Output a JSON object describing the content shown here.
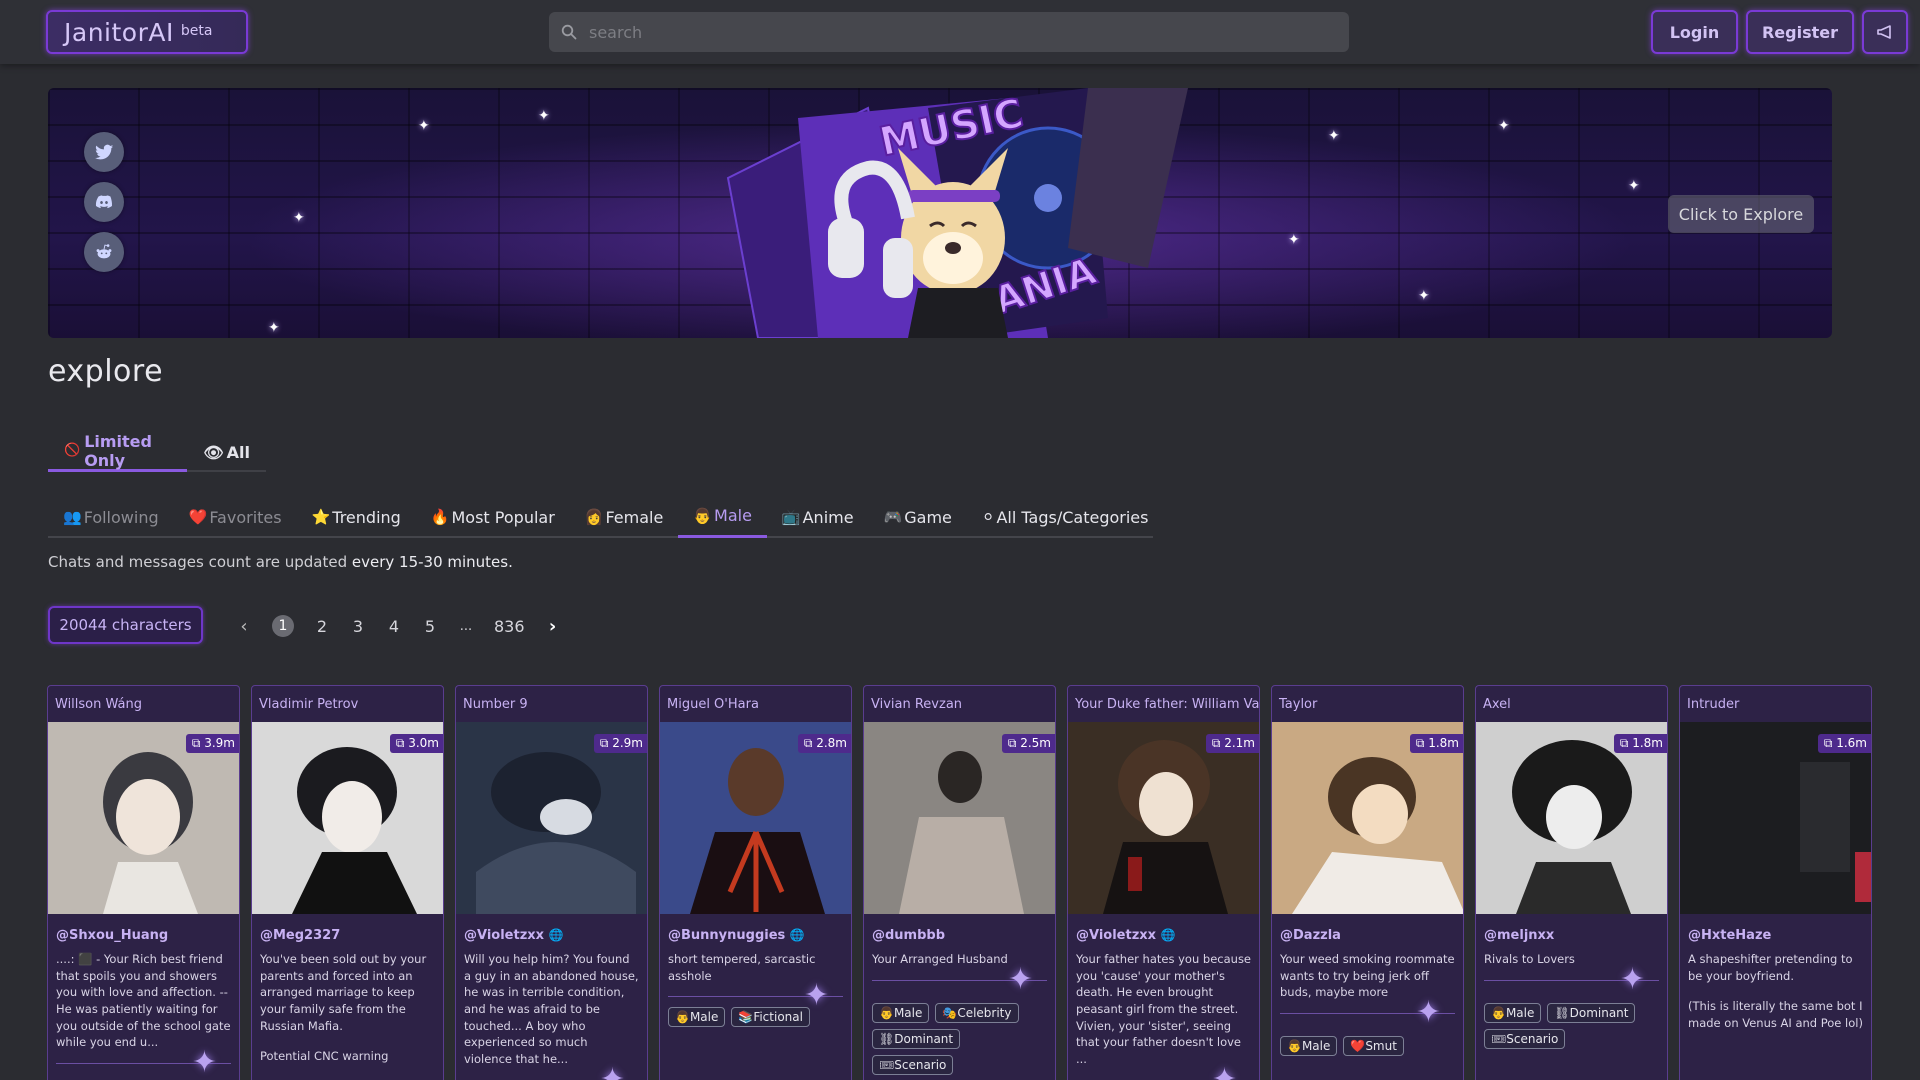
{
  "header": {
    "logo_name": "JanitorAI",
    "logo_badge": "beta",
    "search_placeholder": "search",
    "login_label": "Login",
    "register_label": "Register"
  },
  "banner": {
    "art_words": [
      "MUSIC",
      "MANIA"
    ],
    "explore_label": "Click to Explore"
  },
  "page": {
    "title": "explore",
    "scope_tabs": [
      {
        "icon": "🚫",
        "label": "Limited Only"
      },
      {
        "icon": "👁",
        "label": "All"
      }
    ],
    "category_tabs": [
      {
        "icon": "👥",
        "label": "Following"
      },
      {
        "icon": "❤️",
        "label": "Favorites"
      },
      {
        "icon": "⭐",
        "label": "Trending"
      },
      {
        "icon": "🔥",
        "label": "Most Popular"
      },
      {
        "icon": "👩",
        "label": "Female"
      },
      {
        "icon": "👨",
        "label": "Male"
      },
      {
        "icon": "📺",
        "label": "Anime"
      },
      {
        "icon": "🎮",
        "label": "Game"
      },
      {
        "icon": "⚪",
        "label": "All Tags/Categories"
      }
    ],
    "update_note_prefix": "Chats and messages count are updated ",
    "update_note_bold": "every 15-30 minutes."
  },
  "pagination": {
    "count_label": "20044 characters",
    "pages": [
      "1",
      "2",
      "3",
      "4",
      "5",
      "...",
      "836"
    ],
    "prev_icon": "‹",
    "next_icon": "›"
  },
  "colors": {
    "accent": "#8a5ae0",
    "card_bg": "#2d2246",
    "background": "#2b2c31"
  },
  "cards": [
    {
      "name": "Willson Wáng",
      "chats": "3.9m",
      "creator": "@Shxou_Huang",
      "verified": false,
      "desc": "....: ⬛ - Your Rich best friend that spoils you and showers you with love and affection. -- He was patiently waiting for you outside of the school gate while you end u...",
      "desc2": "",
      "tags": []
    },
    {
      "name": "Vladimir Petrov",
      "chats": "3.0m",
      "creator": "@Meg2327",
      "verified": false,
      "desc": "You've been sold out by your parents and forced into an arranged marriage to keep your family safe from the Russian Mafia.",
      "desc2": "Potential CNC warning",
      "tags": []
    },
    {
      "name": "Number 9",
      "chats": "2.9m",
      "creator": "@Violetzxx",
      "verified": true,
      "desc": "Will you help him? You found a guy in an abandoned house, he was in terrible condition, and he was afraid to be touched... A boy who experienced so much violence that he...",
      "desc2": "",
      "tags": []
    },
    {
      "name": "Miguel O'Hara",
      "chats": "2.8m",
      "creator": "@Bunnynuggies",
      "verified": true,
      "desc": "short tempered, sarcastic asshole",
      "desc2": "",
      "tags": [
        "👨Male",
        "📚Fictional"
      ]
    },
    {
      "name": "Vivian Revzan",
      "chats": "2.5m",
      "creator": "@dumbbb",
      "verified": false,
      "desc": "Your Arranged Husband",
      "desc2": "",
      "tags": [
        "👨Male",
        "🎭Celebrity",
        "⛓Dominant",
        "🎟Scenario"
      ]
    },
    {
      "name": "Your Duke father: William Van",
      "chats": "2.1m",
      "creator": "@Violetzxx",
      "verified": true,
      "desc": "Your father hates you because you 'cause' your mother's death. He even brought peasant girl from the street. Vivien, your 'sister', seeing that your father doesn't love ...",
      "desc2": "",
      "tags": []
    },
    {
      "name": "Taylor",
      "chats": "1.8m",
      "creator": "@Dazzla",
      "verified": false,
      "desc": "Your weed smoking roommate wants to try being jerk off buds, maybe more",
      "desc2": "",
      "tags": [
        "👨Male",
        "❤️Smut"
      ]
    },
    {
      "name": "Axel",
      "chats": "1.8m",
      "creator": "@meljnxx",
      "verified": false,
      "desc": "Rivals to Lovers",
      "desc2": "",
      "tags": [
        "👨Male",
        "⛓Dominant",
        "🎟Scenario"
      ]
    },
    {
      "name": "Intruder",
      "chats": "1.6m",
      "creator": "@HxteHaze",
      "verified": false,
      "desc": "A shapeshifter pretending to be your boyfriend.",
      "desc2": "(This is literally the same bot I made on Venus AI and Poe lol)",
      "tags": []
    }
  ]
}
